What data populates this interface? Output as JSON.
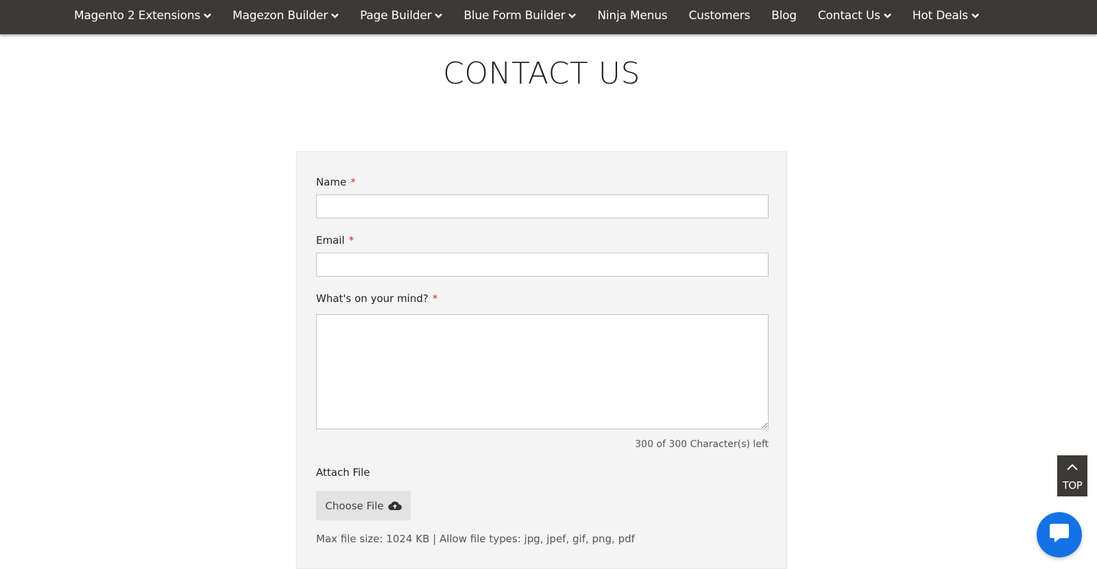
{
  "nav": {
    "items": [
      {
        "label": "Magento 2 Extensions",
        "has_dropdown": true
      },
      {
        "label": "Magezon Builder",
        "has_dropdown": true
      },
      {
        "label": "Page Builder",
        "has_dropdown": true
      },
      {
        "label": "Blue Form Builder",
        "has_dropdown": true
      },
      {
        "label": "Ninja Menus",
        "has_dropdown": false
      },
      {
        "label": "Customers",
        "has_dropdown": false
      },
      {
        "label": "Blog",
        "has_dropdown": false
      },
      {
        "label": "Contact Us",
        "has_dropdown": true
      },
      {
        "label": "Hot Deals",
        "has_dropdown": true
      }
    ]
  },
  "page": {
    "title": "CONTACT US"
  },
  "form": {
    "name_label": "Name",
    "email_label": "Email",
    "message_label": "What's on your mind?",
    "required_mark": "*",
    "name_value": "",
    "email_value": "",
    "message_value": "",
    "char_counter": "300 of 300 Character(s) left",
    "attach_label": "Attach File",
    "choose_file_label": "Choose File",
    "file_note": "Max file size: 1024 KB | Allow file types: jpg, jpef, gif, png, pdf"
  },
  "scroll_top": {
    "label": "TOP"
  },
  "icons": {
    "dropdown": "chevron-down-icon",
    "upload": "cloud-upload-icon",
    "scroll_top": "chevron-up-icon",
    "chat": "chat-bubble-icon"
  },
  "colors": {
    "nav_bg": "#3b3a36",
    "required": "#e02b27",
    "chat": "#1472e6",
    "panel_bg": "#f4f4f4"
  }
}
